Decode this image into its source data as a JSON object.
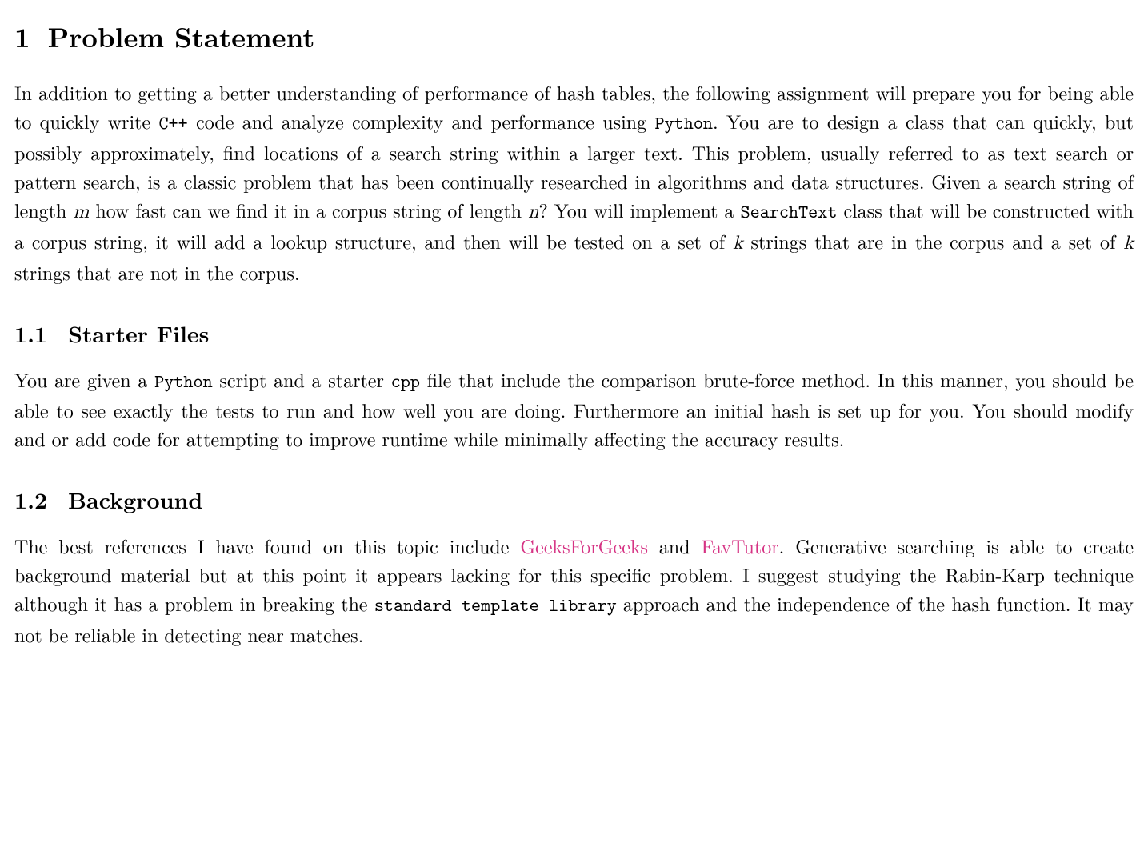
{
  "section": {
    "number": "1",
    "title": "Problem Statement"
  },
  "intro": {
    "p1a": "In addition to getting a better understanding of performance of hash tables, the following assignment will prepare you for being able to quickly write ",
    "code_cpp": "C++",
    "p1b": " code and analyze complexity and performance using ",
    "code_python": "Python",
    "p1c": ". You are to design a class that can quickly, but possibly approximately, find locations of a search string within a larger text. This problem, usually referred to as text search or pattern search, is a classic problem that has been continually researched in algorithms and data structures. Given a search string of length ",
    "var_m": "m",
    "p1d": " how fast can we find it in a corpus string of length ",
    "var_n": "n",
    "p1e": "? You will implement a ",
    "code_searchtext": "SearchText",
    "p1f": " class that will be constructed with a corpus string, it will add a lookup structure, and then will be tested on a set of ",
    "var_k1": "k",
    "p1g": " strings that are in the corpus and a set of ",
    "var_k2": "k",
    "p1h": " strings that are not in the corpus."
  },
  "sub1": {
    "number": "1.1",
    "title": "Starter Files",
    "p1a": "You are given a ",
    "code_python": "Python",
    "p1b": " script and a starter ",
    "code_cpp": "cpp",
    "p1c": " file that include the comparison brute-force method. In this manner, you should be able to see exactly the tests to run and how well you are doing. Furthermore an initial hash is set up for you. You should modify and or add code for attempting to improve runtime while minimally affecting the accuracy results."
  },
  "sub2": {
    "number": "1.2",
    "title": "Background",
    "p1a": "The best references I have found on this topic include ",
    "link1": "GeeksForGeeks",
    "p1b": " and ",
    "link2": "FavTutor",
    "p1c": ". Generative searching is able to create background material but at this point it appears lacking for this specific problem. I suggest studying the Rabin-Karp technique although it has a problem in breaking the ",
    "code_stl": "standard template library",
    "p1d": " approach and the independence of the hash function. It may not be reliable in detecting near matches."
  }
}
